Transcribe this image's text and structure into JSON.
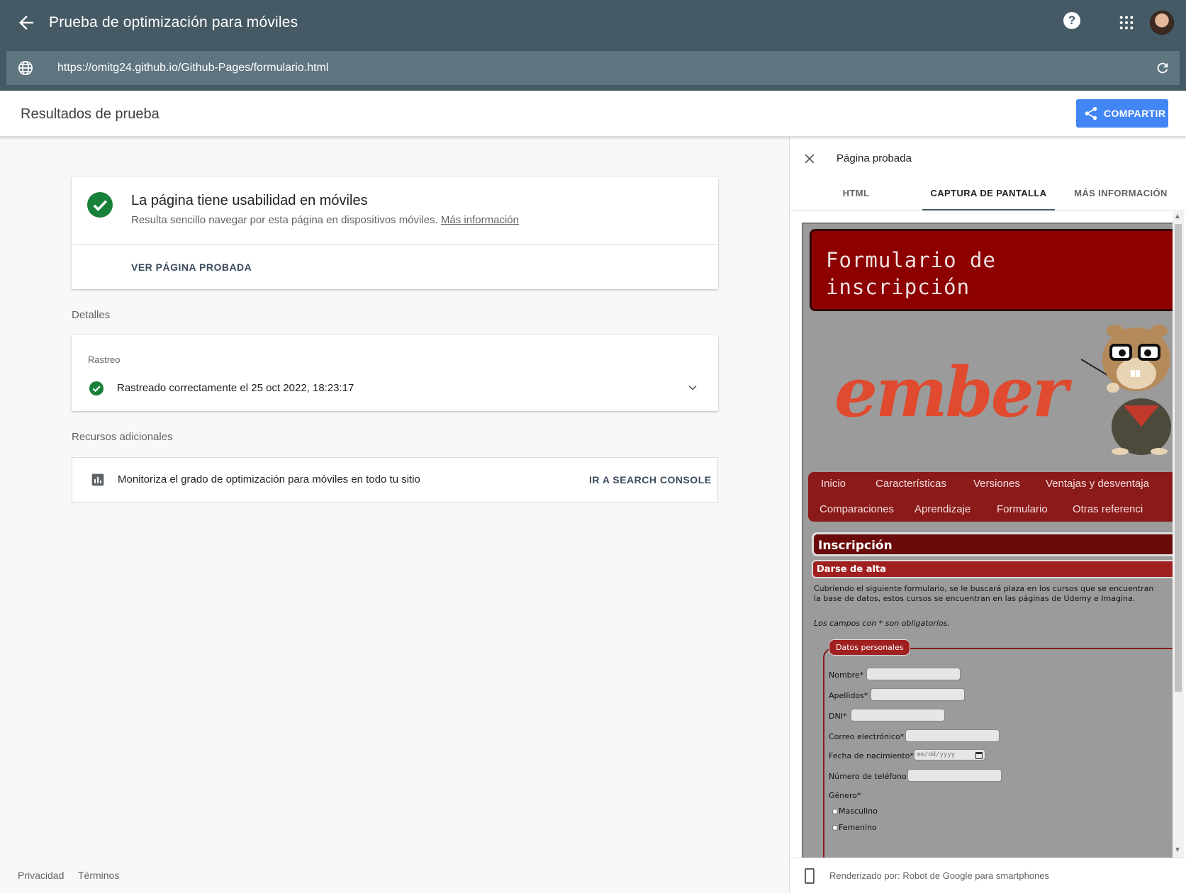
{
  "header": {
    "title": "Prueba de optimización para móviles",
    "help_label": "?",
    "url": "https://omitg24.github.io/Github-Pages/formulario.html"
  },
  "results": {
    "title": "Resultados de prueba",
    "share_label": "COMPARTIR"
  },
  "summary": {
    "heading": "La página tiene usabilidad en móviles",
    "subtext": "Resulta sencillo navegar por esta página en dispositivos móviles.",
    "more_link": "Más información",
    "view_tested": "VER PÁGINA PROBADA"
  },
  "details": {
    "label": "Detalles",
    "crawl_label": "Rastreo",
    "crawl_status": "Rastreado correctamente el 25 oct 2022, 18:23:17"
  },
  "resources": {
    "label": "Recursos adicionales",
    "monitor_text": "Monitoriza el grado de optimización para móviles en todo tu sitio",
    "console_link": "IR A SEARCH CONSOLE"
  },
  "footer": {
    "privacy": "Privacidad",
    "terms": "Términos"
  },
  "panel": {
    "title": "Página probada",
    "tabs": [
      "HTML",
      "CAPTURA DE PANTALLA",
      "MÁS INFORMACIÓN"
    ],
    "active_tab": "CAPTURA DE PANTALLA",
    "rendered_by": "Renderizado por: Robot de Google para smartphones"
  },
  "screenshot": {
    "site_title": "Formulario de inscripción",
    "logo_text": "ember",
    "nav": [
      "Inicio",
      "Características",
      "Versiones",
      "Ventajas y desventaja",
      "Comparaciones",
      "Aprendizaje",
      "Formulario",
      "Otras referenci"
    ],
    "section_title": "Inscripción",
    "subsection_title": "Darse de alta",
    "intro_line1": "Cubriendo el siguiente formulario, se le buscará plaza en los cursos que se encuentran",
    "intro_line2": "la base de datos, estos cursos se encuentran en las páginas de Udemy e Imagina.",
    "required_note": "Los campos con * son obligatorios.",
    "fieldset_legend": "Datos personales",
    "fields": [
      "Nombre*",
      "Apellidos*",
      "DNI*",
      "Correo electrónico*",
      "Fecha de nacimiento*",
      "Número de teléfono",
      "Género*"
    ],
    "date_placeholder": "mm/dd/yyyy",
    "gender_options": [
      "Masculino",
      "Femenino"
    ]
  },
  "colors": {
    "header_bg": "#455a64",
    "url_bg": "#5f7580",
    "accent_blue": "#4285f4",
    "success_green": "#188038",
    "site_red": "#8d0000"
  }
}
